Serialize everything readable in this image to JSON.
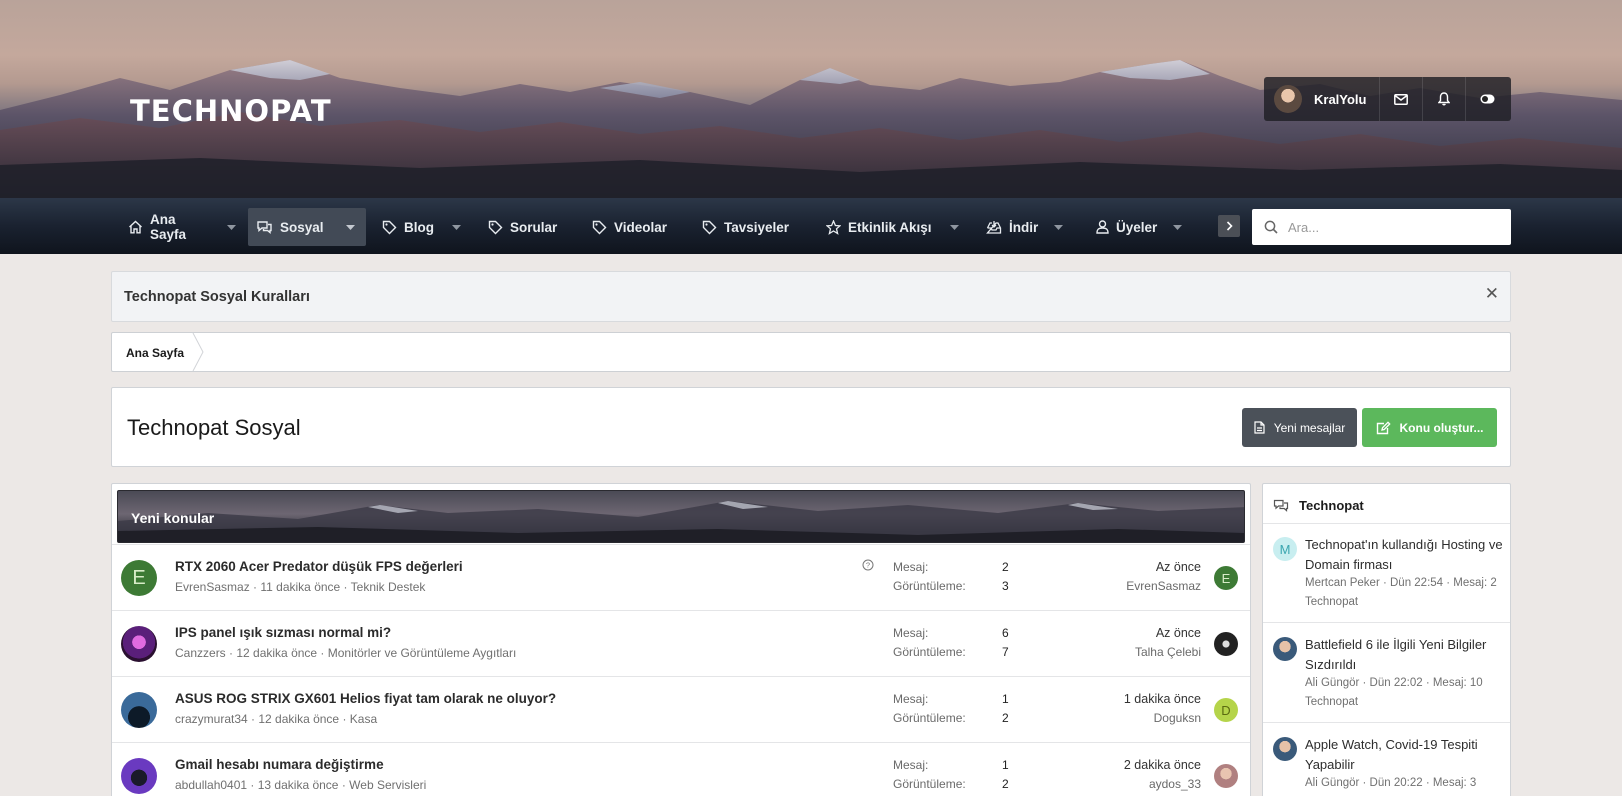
{
  "header": {
    "logo": "TECHNOPAT",
    "username": "KralYolu"
  },
  "nav": {
    "items": [
      {
        "label": "Ana Sayfa",
        "icon": "home-icon",
        "caret": true
      },
      {
        "label": "Sosyal",
        "icon": "chat-icon",
        "caret": true,
        "active": true
      },
      {
        "label": "Blog",
        "icon": "tag-icon",
        "caret": true
      },
      {
        "label": "Sorular",
        "icon": "tag-icon",
        "caret": false
      },
      {
        "label": "Videolar",
        "icon": "tag-icon",
        "caret": false
      },
      {
        "label": "Tavsiyeler",
        "icon": "tag-icon",
        "caret": false
      },
      {
        "label": "Etkinlik Akışı",
        "icon": "star-icon",
        "caret": true
      },
      {
        "label": "İndir",
        "icon": "inbox-download-icon",
        "caret": true
      },
      {
        "label": "Üyeler",
        "icon": "user-icon",
        "caret": true
      }
    ],
    "search_placeholder": "Ara..."
  },
  "notice": {
    "title": "Technopat Sosyal Kuralları"
  },
  "breadcrumb": {
    "home": "Ana Sayfa"
  },
  "page": {
    "title": "Technopat Sosyal",
    "new_messages_label": "Yeni mesajlar",
    "create_thread_label": "Konu oluştur..."
  },
  "threads": {
    "heading": "Yeni konular",
    "replies_label": "Mesaj:",
    "views_label": "Görüntüleme:",
    "rows": [
      {
        "title": "RTX 2060 Acer Predator düşük FPS değerleri",
        "author": "EvrenSasmaz",
        "age": "11 dakika önce",
        "forum": "Teknik Destek",
        "replies": "2",
        "views": "3",
        "last_time": "Az önce",
        "last_user": "EvrenSasmaz",
        "avatar_letter": "E",
        "avatar_color": "#3d7a35",
        "last_avatar_letter": "E",
        "last_avatar_color": "#3d7a35",
        "question": true
      },
      {
        "title": "IPS panel ışık sızması normal mi?",
        "author": "Canzzers",
        "age": "12 dakika önce",
        "forum": "Monitörler ve Görüntüleme Aygıtları",
        "replies": "6",
        "views": "7",
        "last_time": "Az önce",
        "last_user": "Talha Çelebi",
        "avatar_letter": "",
        "avatar_color": "#7a2a8a",
        "last_avatar_letter": "",
        "last_avatar_color": "#2a2a2a",
        "question": false
      },
      {
        "title": "ASUS ROG STRIX GX601 Helios fiyat tam olarak ne oluyor?",
        "author": "crazymurat34",
        "age": "12 dakika önce",
        "forum": "Kasa",
        "replies": "1",
        "views": "2",
        "last_time": "1 dakika önce",
        "last_user": "Doguksn",
        "avatar_letter": "",
        "avatar_color": "#1e3550",
        "last_avatar_letter": "D",
        "last_avatar_color": "#b5d44a",
        "question": false
      },
      {
        "title": "Gmail hesabı numara değiştirme",
        "author": "abdullah0401",
        "age": "13 dakika önce",
        "forum": "Web Servisleri",
        "replies": "1",
        "views": "2",
        "last_time": "2 dakika önce",
        "last_user": "aydos_33",
        "avatar_letter": "",
        "avatar_color": "#4a2a8a",
        "last_avatar_letter": "",
        "last_avatar_color": "#c99a9a",
        "question": false
      }
    ]
  },
  "sidebar": {
    "heading": "Technopat",
    "items": [
      {
        "title": "Technopat'ın kullandığı Hosting ve Domain firması",
        "meta": "Mertcan Peker · Dün 22:54 · Mesaj: 2",
        "forum": "Technopat",
        "avatar_letter": "M",
        "avatar_color": "#c8eef0",
        "avatar_text_color": "#3aa6b0"
      },
      {
        "title": "Battlefield 6 ile İlgili Yeni Bilgiler Sızdırıldı",
        "meta": "Ali Güngör · Dün 22:02 · Mesaj: 10",
        "forum": "Technopat",
        "avatar_letter": "",
        "avatar_color": "#3a5a7a",
        "avatar_text_color": "#fff"
      },
      {
        "title": "Apple Watch, Covid-19 Tespiti Yapabilir",
        "meta": "Ali Güngör · Dün 20:22 · Mesaj: 3",
        "forum": "",
        "avatar_letter": "",
        "avatar_color": "#3a5a7a",
        "avatar_text_color": "#fff"
      }
    ]
  }
}
